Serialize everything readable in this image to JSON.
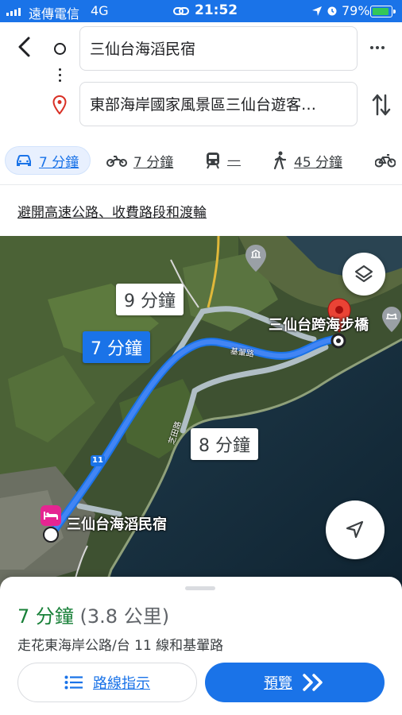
{
  "status_bar": {
    "carrier": "遠傳電信",
    "network": "4G",
    "time": "21:52",
    "battery": "79%"
  },
  "route": {
    "origin": "三仙台海滔民宿",
    "destination": "東部海岸國家風景區三仙台遊客…"
  },
  "modes": [
    {
      "icon": "car-icon",
      "label": "7 分鐘",
      "active": true
    },
    {
      "icon": "motorcycle-icon",
      "label": "7 分鐘"
    },
    {
      "icon": "transit-icon",
      "label": "—"
    },
    {
      "icon": "walk-icon",
      "label": "45 分鐘"
    },
    {
      "icon": "bicycle-icon",
      "label": ""
    }
  ],
  "avoid_text": "避開高速公路、收費路段和渡輪",
  "map": {
    "badges": {
      "primary": "7 分鐘",
      "alt1": "9 分鐘",
      "alt2": "8 分鐘"
    },
    "labels": {
      "destination": "三仙台跨海步橋",
      "origin": "三仙台海滔民宿",
      "road1": "基翬路",
      "road2": "芝田路",
      "route_shield": "11"
    },
    "colors": {
      "route": "#4285f4",
      "alt_route": "#b0bec5",
      "pin": "#ea4335"
    }
  },
  "sheet": {
    "duration": "7 分鐘",
    "distance": "(3.8 公里)",
    "via": "走花東海岸公路/台 11 線和基翬路",
    "steps_button": "路線指示",
    "preview_button": "預覽"
  }
}
